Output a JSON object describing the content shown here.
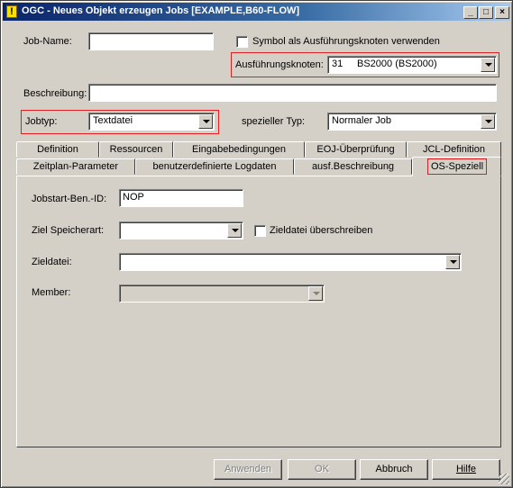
{
  "window": {
    "title": "OGC - Neues Objekt erzeugen Jobs [EXAMPLE,B60-FLOW]",
    "icon_glyph": "!",
    "controls": {
      "minimize": "_",
      "maximize": "□",
      "close": "×"
    }
  },
  "form": {
    "jobname_label": "Job-Name:",
    "jobname_value": "",
    "symbol_checkbox_label": "Symbol als Ausführungsknoten verwenden",
    "symbol_checked": false,
    "node_label": "Ausführungsknoten:",
    "node_number": "31",
    "node_value": "BS2000 (BS2000)",
    "description_label": "Beschreibung:",
    "description_value": "",
    "jobtype_label": "Jobtyp:",
    "jobtype_value": "Textdatei",
    "special_type_label": "spezieller Typ:",
    "special_type_value": "Normaler Job"
  },
  "tabs": {
    "row_back": [
      "Definition",
      "Ressourcen",
      "Eingabebedingungen",
      "EOJ-Überprüfung",
      "JCL-Definition"
    ],
    "row_front": [
      "Zeitplan-Parameter",
      "benutzerdefinierte Logdaten",
      "ausf.Beschreibung",
      "OS-Speziell"
    ],
    "active": "OS-Speziell"
  },
  "os_panel": {
    "jobstart_label": "Jobstart-Ben.-ID:",
    "jobstart_value": "NOP",
    "storage_label": "Ziel Speicherart:",
    "storage_value": "",
    "overwrite_label": "Zieldatei überschreiben",
    "overwrite_checked": false,
    "target_file_label": "Zieldatei:",
    "target_file_value": "",
    "member_label": "Member:",
    "member_value": ""
  },
  "buttons": {
    "apply": "Anwenden",
    "ok": "OK",
    "cancel": "Abbruch",
    "help": "Hilfe"
  },
  "colors": {
    "titlebar_start": "#0a246a",
    "titlebar_end": "#a6caf0",
    "face": "#d4d0c8",
    "highlight": "#e02020"
  }
}
